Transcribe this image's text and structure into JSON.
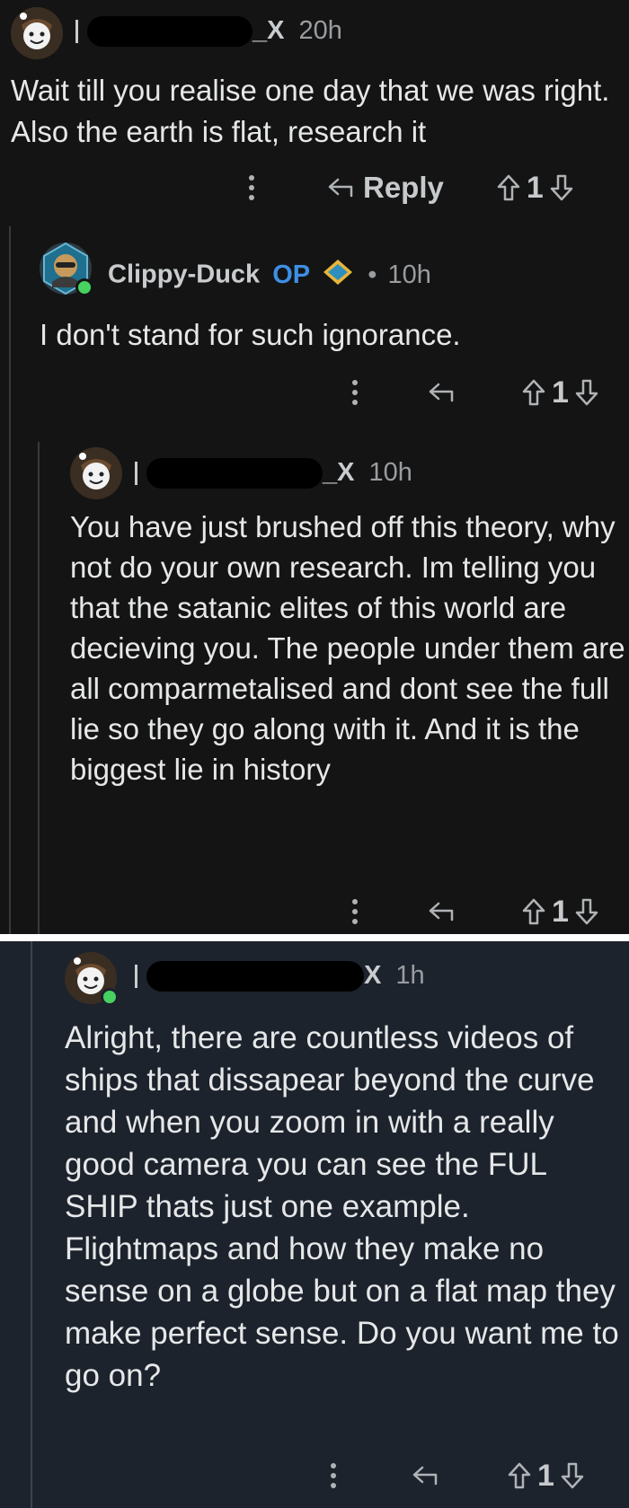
{
  "comments": [
    {
      "username_end": "_X",
      "time": "20h",
      "body": "Wait till you realise one day that we was right. Also the earth is flat, research it",
      "reply_label": "Reply",
      "votes": "1"
    },
    {
      "username": "Clippy-Duck",
      "op_label": "OP",
      "time": "10h",
      "body": "I don't stand for such ignorance.",
      "votes": "1"
    },
    {
      "username_end": "_X",
      "time": "10h",
      "body": "You have just brushed off this theory, why not do your own research. Im telling you that the satanic elites of this world are decieving you. The people under them are all comparmetalised and dont see the full lie so they go along with it. And it is the biggest lie in history",
      "votes": "1"
    },
    {
      "username_end": "X",
      "time": "1h",
      "body": "Alright, there are countless videos of ships that dissapear beyond the curve and when you zoom in with a really good camera you can see the FUL SHIP thats just one example. Flightmaps and how they make no sense on a globe but on a flat map they make perfect sense. Do you want me to go on?",
      "votes": "1"
    }
  ],
  "colors": {
    "background_top": "#141414",
    "background_bottom": "#1c232d",
    "op_blue": "#3d8fe3",
    "online_green": "#46d160"
  },
  "icons": [
    "more-icon",
    "reply-arrow-icon",
    "upvote-icon",
    "downvote-icon",
    "avatar-icon",
    "award-icon"
  ]
}
